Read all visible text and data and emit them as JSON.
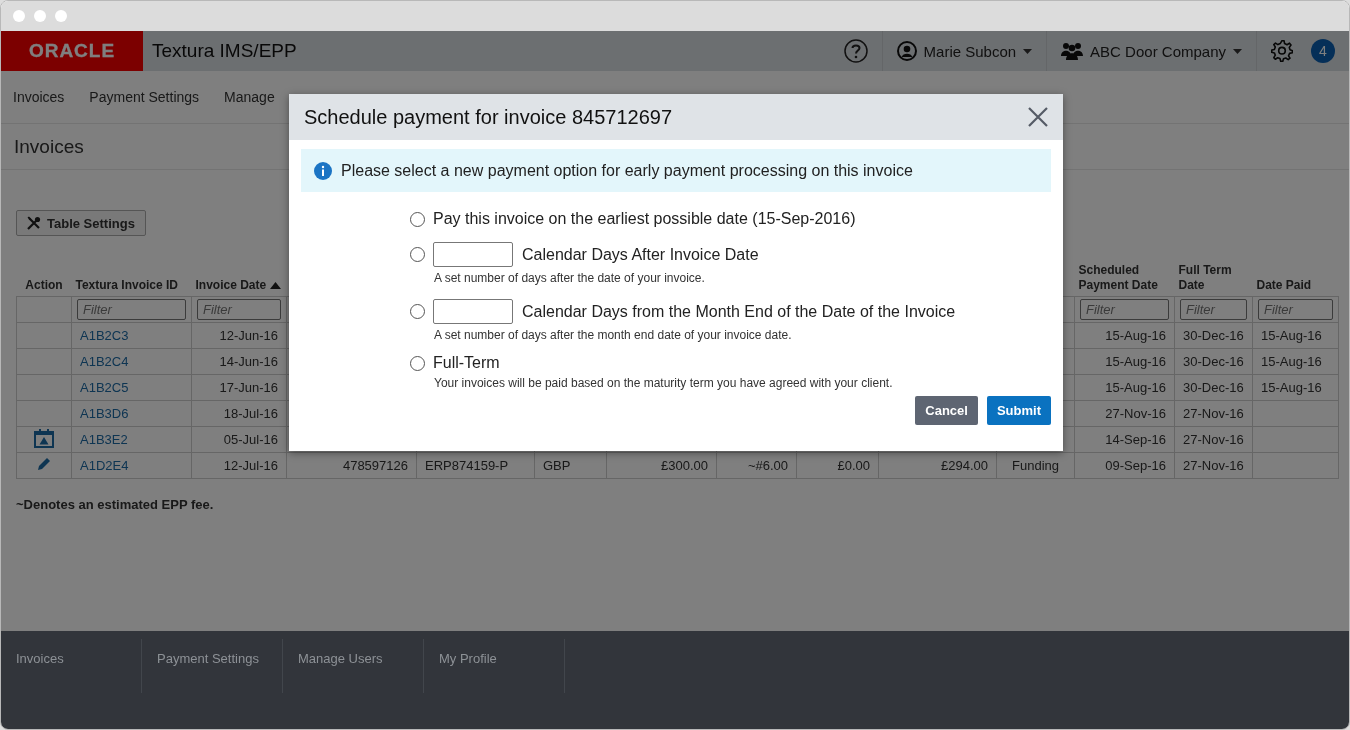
{
  "app_bar": {
    "logo": "ORACLE",
    "product": "Textura IMS/EPP",
    "user": "Marie Subcon",
    "company": "ABC Door Company",
    "notifications": "4"
  },
  "nav": [
    "Invoices",
    "Payment Settings",
    "Manage"
  ],
  "page_title": "Invoices",
  "table_settings_button": "Table Settings",
  "table": {
    "columns": [
      {
        "header": "Action",
        "sorted_ascending": false
      },
      {
        "header": "Textura Invoice ID",
        "sorted_ascending": false,
        "filter_placeholder": "Filter"
      },
      {
        "header": "Invoice Date",
        "sorted_ascending": true,
        "filter_placeholder": "Filter"
      },
      {
        "header": "Scheduled Payment Date",
        "sorted_ascending": false,
        "filter_placeholder": "Filter"
      },
      {
        "header": "Full Term Date",
        "sorted_ascending": false,
        "filter_placeholder": "Filter"
      },
      {
        "header": "Date Paid",
        "sorted_ascending": false,
        "filter_placeholder": "Filter"
      }
    ],
    "rows": [
      {
        "textura_invoice_id": "A1B2C3",
        "invoice_date": "12-Jun-16",
        "scheduled_payment_date": "15-Aug-16",
        "full_term_date": "30-Dec-16",
        "date_paid": "15-Aug-16"
      },
      {
        "textura_invoice_id": "A1B2C4",
        "invoice_date": "14-Jun-16",
        "scheduled_payment_date": "15-Aug-16",
        "full_term_date": "30-Dec-16",
        "date_paid": "15-Aug-16"
      },
      {
        "textura_invoice_id": "A1B2C5",
        "invoice_date": "17-Jun-16",
        "scheduled_payment_date": "15-Aug-16",
        "full_term_date": "30-Dec-16",
        "date_paid": "15-Aug-16"
      },
      {
        "textura_invoice_id": "A1B3D6",
        "invoice_date": "18-Jul-16",
        "scheduled_payment_date": "27-Nov-16",
        "full_term_date": "27-Nov-16"
      },
      {
        "action": {
          "kind": "schedule"
        },
        "textura_invoice_id": "A1B3E2",
        "invoice_date": "05-Jul-16",
        "scheduled_payment_date": "14-Sep-16",
        "full_term_date": "27-Nov-16"
      },
      {
        "action": {
          "kind": "edit"
        },
        "textura_invoice_id": "A1D2E4",
        "invoice_date": "12-Jul-16",
        "column_4": "478597126",
        "column_5": "ERP874159-P",
        "column_6": "GBP",
        "column_7": "£300.00",
        "column_8": "~#6.00",
        "column_9": "£0.00",
        "column_10": "£294.00",
        "column_11": "Funding",
        "scheduled_payment_date": "09-Sep-16",
        "full_term_date": "27-Nov-16"
      }
    ]
  },
  "note": "~Denotes an estimated EPP fee.",
  "modal": {
    "title": "Schedule payment for invoice 845712697",
    "info": "Please select a new payment option for early payment processing on this invoice",
    "options": [
      {
        "kind": "plain",
        "label": "Pay this invoice on the earliest possible date (15-Sep-2016)",
        "selected": false
      },
      {
        "kind": "days_field",
        "label": "Calendar Days After Invoice Date",
        "hint": "A set number of days after the date of your invoice.",
        "selected": false
      },
      {
        "kind": "days_field",
        "label": "Calendar Days from the Month End of the Date of the Invoice",
        "hint": "A set number of days after the month end date of your invoice date.",
        "selected": false
      },
      {
        "kind": "hinted",
        "label": "Full-Term",
        "hint": "Your invoices will be paid based on the maturity term you have agreed with your client.",
        "selected": false
      }
    ],
    "buttons": [
      {
        "kind": "secondary",
        "label": "Cancel"
      },
      {
        "kind": "primary",
        "label": "Submit"
      }
    ]
  },
  "footer": [
    "Invoices",
    "Payment Settings",
    "Manage Users",
    "My Profile"
  ]
}
